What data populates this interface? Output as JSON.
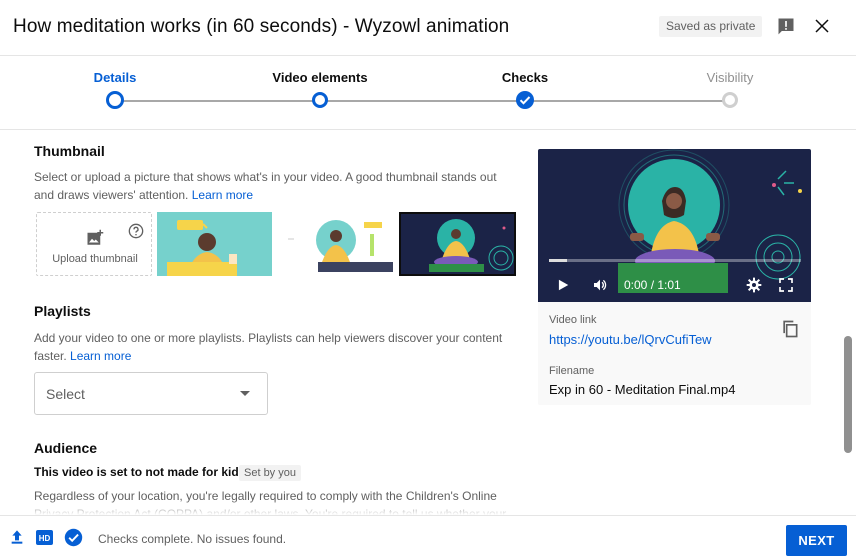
{
  "header": {
    "title": "How meditation works (in 60 seconds) - Wyzowl animation",
    "saved_badge": "Saved as private"
  },
  "stepper": {
    "steps": [
      {
        "label": "Details",
        "state": "current"
      },
      {
        "label": "Video elements",
        "state": "done"
      },
      {
        "label": "Checks",
        "state": "checked"
      },
      {
        "label": "Visibility",
        "state": "pending"
      }
    ]
  },
  "thumbnail": {
    "title": "Thumbnail",
    "description": "Select or upload a picture that shows what's in your video. A good thumbnail stands out and draws viewers' attention.",
    "learn_more": "Learn more",
    "upload_label": "Upload thumbnail"
  },
  "playlists": {
    "title": "Playlists",
    "description": "Add your video to one or more playlists. Playlists can help viewers discover your content faster.",
    "learn_more": "Learn more",
    "select_value": "Select"
  },
  "audience": {
    "title": "Audience",
    "kids_status": "This video is set to not made for kids",
    "set_badge": "Set by you",
    "description": "Regardless of your location, you're legally required to comply with the Children's Online Privacy Protection Act (COPPA) and/or other laws. You're required to tell us whether your"
  },
  "preview": {
    "time": "0:00 / 1:01",
    "progress": 0.07,
    "video_link_label": "Video link",
    "video_link": "https://youtu.be/lQrvCufiTew",
    "filename_label": "Filename",
    "filename": "Exp in 60 - Meditation Final.mp4"
  },
  "footer": {
    "status": "Checks complete. No issues found.",
    "next_label": "NEXT"
  },
  "colors": {
    "accent": "#065fd4",
    "video_bg": "#1b2347",
    "teal": "#2ab3a6"
  }
}
